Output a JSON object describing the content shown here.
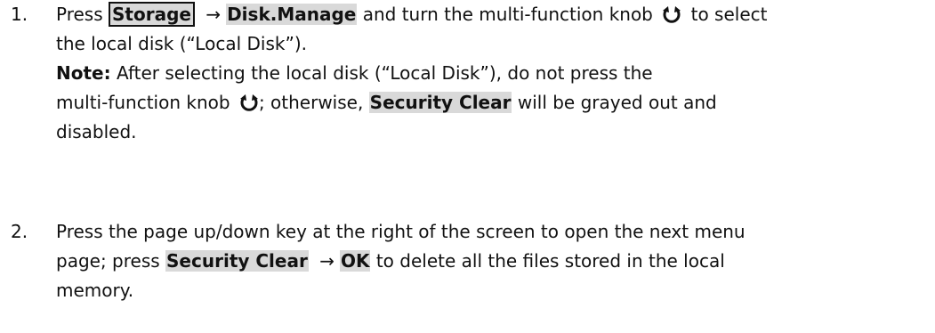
{
  "step1": {
    "number": "1.",
    "press": "Press",
    "menu_storage": "Storage",
    "arrow": "→",
    "menu_disk_manage": "Disk.Manage",
    "text_turn": "and turn the multi-function knob",
    "knob_icon": "rotate-knob-icon",
    "text_to_select": "to select",
    "line2": "the local disk (“Local Disk”).",
    "note_label": "Note:",
    "note_text1": "After selecting the local disk (“Local Disk”), do not press the",
    "note_text2a": "multi-function knob",
    "note_text2b": "; otherwise,",
    "menu_security_clear": "Security Clear",
    "note_text2c": "will be grayed out and",
    "note_text3": "disabled."
  },
  "step2": {
    "number": "2.",
    "line1": "Press the page up/down key at the right of the screen to open the next menu",
    "line2a": "page; press",
    "menu_security_clear": "Security Clear",
    "arrow": "→",
    "menu_ok": "OK",
    "line2b": "to delete all the files stored in the local",
    "line3": "memory."
  }
}
